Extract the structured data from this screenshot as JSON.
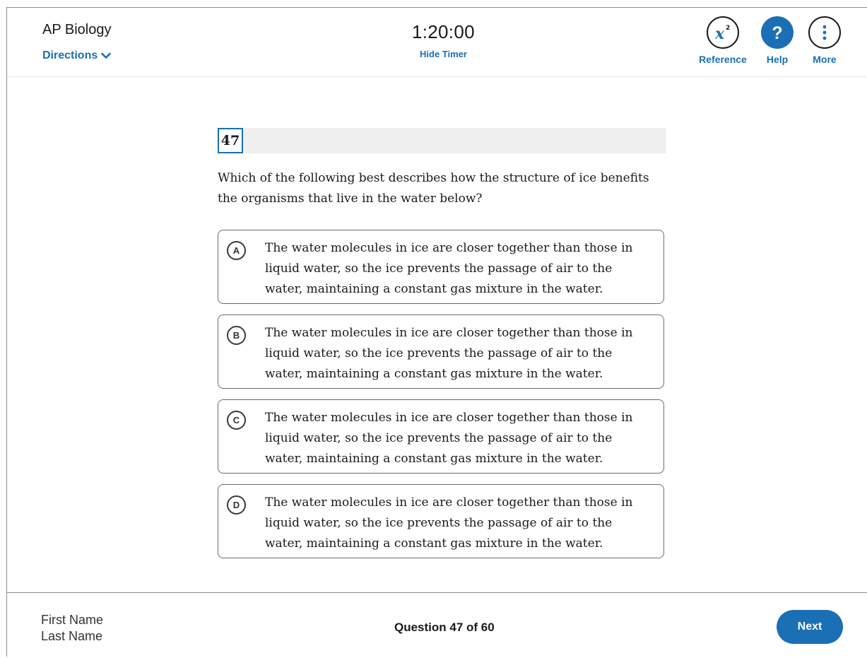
{
  "header": {
    "exam_title": "AP Biology",
    "directions_label": "Directions",
    "timer": "1:20:00",
    "hide_timer_label": "Hide Timer",
    "tools": {
      "reference": "Reference",
      "help": "Help",
      "more": "More"
    }
  },
  "question": {
    "number": "47",
    "stem": "Which of the following best describes how the structure of ice benefits the organisms that live in the water below?",
    "choices": [
      {
        "letter": "A",
        "text": "The water molecules in ice are closer together than those in liquid water, so the ice prevents the passage of air to the water, maintaining a constant gas mixture in the water."
      },
      {
        "letter": "B",
        "text": "The water molecules in ice are closer together than those in liquid water, so the ice prevents the passage of air to the water, maintaining a constant gas mixture in the water."
      },
      {
        "letter": "C",
        "text": "The water molecules in ice are closer together than those in liquid water, so the ice prevents the passage of air to the water, maintaining a constant gas mixture in the water."
      },
      {
        "letter": "D",
        "text": "The water molecules in ice are closer together than those in liquid water, so the ice prevents the passage of air to the water, maintaining a constant gas mixture in the water."
      }
    ]
  },
  "footer": {
    "first_name": "First Name",
    "last_name": "Last Name",
    "progress": "Question 47 of 60",
    "next_label": "Next"
  },
  "colors": {
    "accent": "#1a6fb5",
    "text": "#1a1a1a",
    "question_bar": "#f0f0f0"
  }
}
